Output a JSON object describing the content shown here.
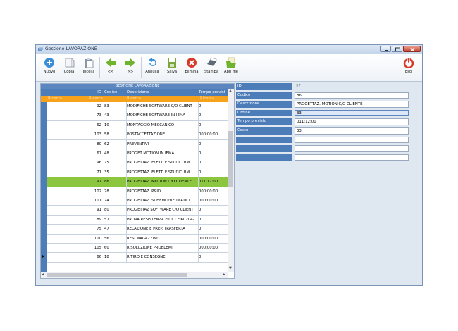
{
  "window": {
    "title": "Gestione LAVORAZIONE"
  },
  "toolbar": {
    "buttons": [
      {
        "label": "Nuovo",
        "icon": "plus-circle-icon",
        "color": "#3a8ed8"
      },
      {
        "label": "Copia",
        "icon": "copy-icon",
        "color": "#9aa3ad"
      },
      {
        "label": "Incolla",
        "icon": "paste-icon",
        "color": "#8a96a8"
      },
      {
        "label": "<<",
        "icon": "arrow-left-icon",
        "color": "#6fb42c"
      },
      {
        "label": ">>",
        "icon": "arrow-right-icon",
        "color": "#6fb42c"
      },
      {
        "label": "Annulla",
        "icon": "undo-icon",
        "color": "#3a8ed8"
      },
      {
        "label": "Salva",
        "icon": "save-icon",
        "color": "#7aa640"
      },
      {
        "label": "Elimina",
        "icon": "delete-icon",
        "color": "#d83a2a"
      },
      {
        "label": "Stampa",
        "icon": "print-icon",
        "color": "#5f6a78"
      },
      {
        "label": "Apri file",
        "icon": "open-file-icon",
        "color": "#6fb42c"
      }
    ],
    "exit": {
      "label": "Esci",
      "icon": "power-icon",
      "color": "#d83a2a"
    }
  },
  "grid": {
    "caption": "GESTIONE LAVORAZIONE",
    "columns": [
      "ID",
      "Codice",
      "Descrizione",
      "Tempo previst"
    ],
    "filters": [
      "Ricerca",
      "Ricerca",
      "Ricerca",
      "Ricerca"
    ],
    "rows": [
      {
        "id": "92",
        "codice": "83",
        "descrizione": "MODIFICHE SOFTWARE C/O CLIENT",
        "tempo": "0"
      },
      {
        "id": "73",
        "codice": "43",
        "descrizione": "MODIFICHE SOFTWARE IN IEMA",
        "tempo": "0"
      },
      {
        "id": "62",
        "codice": "10",
        "descrizione": "MONTAGGIO MECCANICO",
        "tempo": "0"
      },
      {
        "id": "103",
        "codice": "58",
        "descrizione": "POSTACCETTAZIONE",
        "tempo": "000:00:00"
      },
      {
        "id": "80",
        "codice": "62",
        "descrizione": "PREVENTIVI",
        "tempo": "0"
      },
      {
        "id": "61",
        "codice": "48",
        "descrizione": "PROGET MOTION IN IEMA",
        "tempo": "0"
      },
      {
        "id": "96",
        "codice": "75",
        "descrizione": "PROGETTAZ. ELETT. E STUDIO BM",
        "tempo": "0"
      },
      {
        "id": "71",
        "codice": "35",
        "descrizione": "PROGETTAZ. ELETT. E STUDIO BM",
        "tempo": "0"
      },
      {
        "id": "97",
        "codice": "86",
        "descrizione": "PROGETTAZ. MOTION C/O CLIENTE",
        "tempo": "011:12:00",
        "selected": true
      },
      {
        "id": "102",
        "codice": "78",
        "descrizione": "PROGETTAZ. P&ID",
        "tempo": "000:00:00"
      },
      {
        "id": "101",
        "codice": "74",
        "descrizione": "PROGETTAZ. SCHEMI PNEUMATICI",
        "tempo": "000:00:00"
      },
      {
        "id": "91",
        "codice": "80",
        "descrizione": "PROGETTAZ SOFTWARE C/O CLIENT",
        "tempo": "0"
      },
      {
        "id": "89",
        "codice": "57",
        "descrizione": "PROVA RESISTENZA ISOL.CEI60204-",
        "tempo": "0"
      },
      {
        "id": "75",
        "codice": "47",
        "descrizione": "RELAZIONE E PREP. TRASFERTA",
        "tempo": "0"
      },
      {
        "id": "100",
        "codice": "56",
        "descrizione": "RESI MAGAZZINO",
        "tempo": "000:00:00"
      },
      {
        "id": "105",
        "codice": "60",
        "descrizione": "RISOLUZIONE PROBLEMI",
        "tempo": "000:00:00"
      },
      {
        "id": "66",
        "codice": "18",
        "descrizione": "RITIRO E CONSEGNE",
        "tempo": "0"
      }
    ]
  },
  "form": {
    "fields": [
      {
        "label": "ID",
        "value": "97",
        "readonly": true
      },
      {
        "label": "Codice",
        "value": "86"
      },
      {
        "label": "Descrizione",
        "value": "PROGETTAZ. MOTION C/O CLIENTE"
      },
      {
        "label": "Ordine",
        "value": "33",
        "focused": true
      },
      {
        "label": "Tempo previsto",
        "value": "011:12:00"
      },
      {
        "label": "Costo",
        "value": "33"
      },
      {
        "label": "",
        "value": ""
      },
      {
        "label": "",
        "value": ""
      },
      {
        "label": "",
        "value": ""
      }
    ]
  }
}
